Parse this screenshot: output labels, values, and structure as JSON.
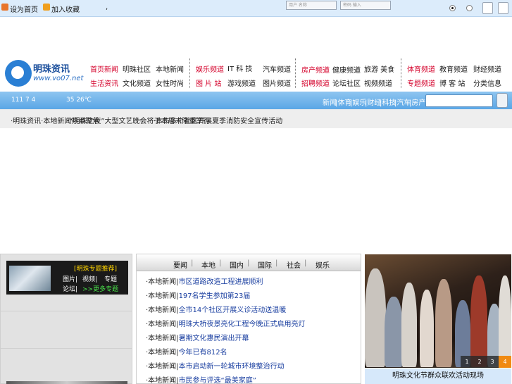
{
  "topbar": {
    "link1": "设为首页",
    "link2": "加入收藏",
    "comma": ",",
    "input1_placeholder": "用户 名称",
    "input2_placeholder": "密码 输入"
  },
  "logo": {
    "name": "明珠资讯",
    "url": "www.vo07.net"
  },
  "nav": {
    "row1": [
      "首页新闻",
      "明珠社区",
      "本地新闻",
      "娱乐频道",
      "IT 科 技",
      "汽车频道",
      "房产频道",
      "健康频道",
      "旅游 美食",
      "体育频道",
      "教育频道",
      "财经频道"
    ],
    "row2": [
      "生活资讯",
      "文化频道",
      "女性时尚",
      "图 片 站",
      "游戏频道",
      "图片频道",
      "招聘频道",
      "论坛社区",
      "视频频道",
      "专题频道",
      "博 客 站",
      "分类信息"
    ]
  },
  "strip": {
    "date": "111 7 4",
    "weather": "35 26℃",
    "categories": [
      "新闻",
      "|体育",
      "|娱乐",
      "|财经",
      "|科技",
      "|汽车",
      "|房产"
    ]
  },
  "ticker": {
    "items": [
      "·明珠资讯·本地新闻热点聚焦",
      "·“明珠之夜”大型文艺晚会将于本周末隆重举行",
      "·本市多个社区开展夏季消防安全宣传活动"
    ]
  },
  "left": {
    "promo_title": "[明珠专题推荐]",
    "links": [
      "图片|",
      "视频|",
      "专题",
      "论坛|"
    ],
    "more": ">>更多专题"
  },
  "mid": {
    "tabs": [
      "要闻",
      "本地",
      "国内",
      "国际",
      "社会",
      "娱乐"
    ],
    "rows": [
      {
        "tag": "·本地新闻|",
        "text": "市区道路改造工程进展顺利"
      },
      {
        "tag": "·本地新闻|",
        "text": "197名学生参加第23届"
      },
      {
        "tag": "·本地新闻|",
        "text": "全市14个社区开展义诊活动送温暖"
      },
      {
        "tag": "·本地新闻|",
        "text": "明珠大桥夜景亮化工程今晚正式启用亮灯"
      },
      {
        "tag": "·本地新闻|",
        "text": "暑期文化惠民演出开幕"
      },
      {
        "tag": "·本地新闻|",
        "text": "今年已有812名"
      },
      {
        "tag": "·本地新闻|",
        "text": "本市启动新一轮城市环境整治行动"
      },
      {
        "tag": "·本地新闻|",
        "text": "市民参与评选“最美家庭”"
      }
    ]
  },
  "right": {
    "pager": [
      "1",
      "2",
      "3",
      "4"
    ],
    "active_page": "4",
    "caption": "明珠文化节群众联欢活动现场"
  },
  "colors": {
    "nav_red": "#d4002a",
    "strip_blue": "#5aa6e6",
    "pager_active": "#f08a12",
    "link_blue": "#1a3fa0"
  }
}
